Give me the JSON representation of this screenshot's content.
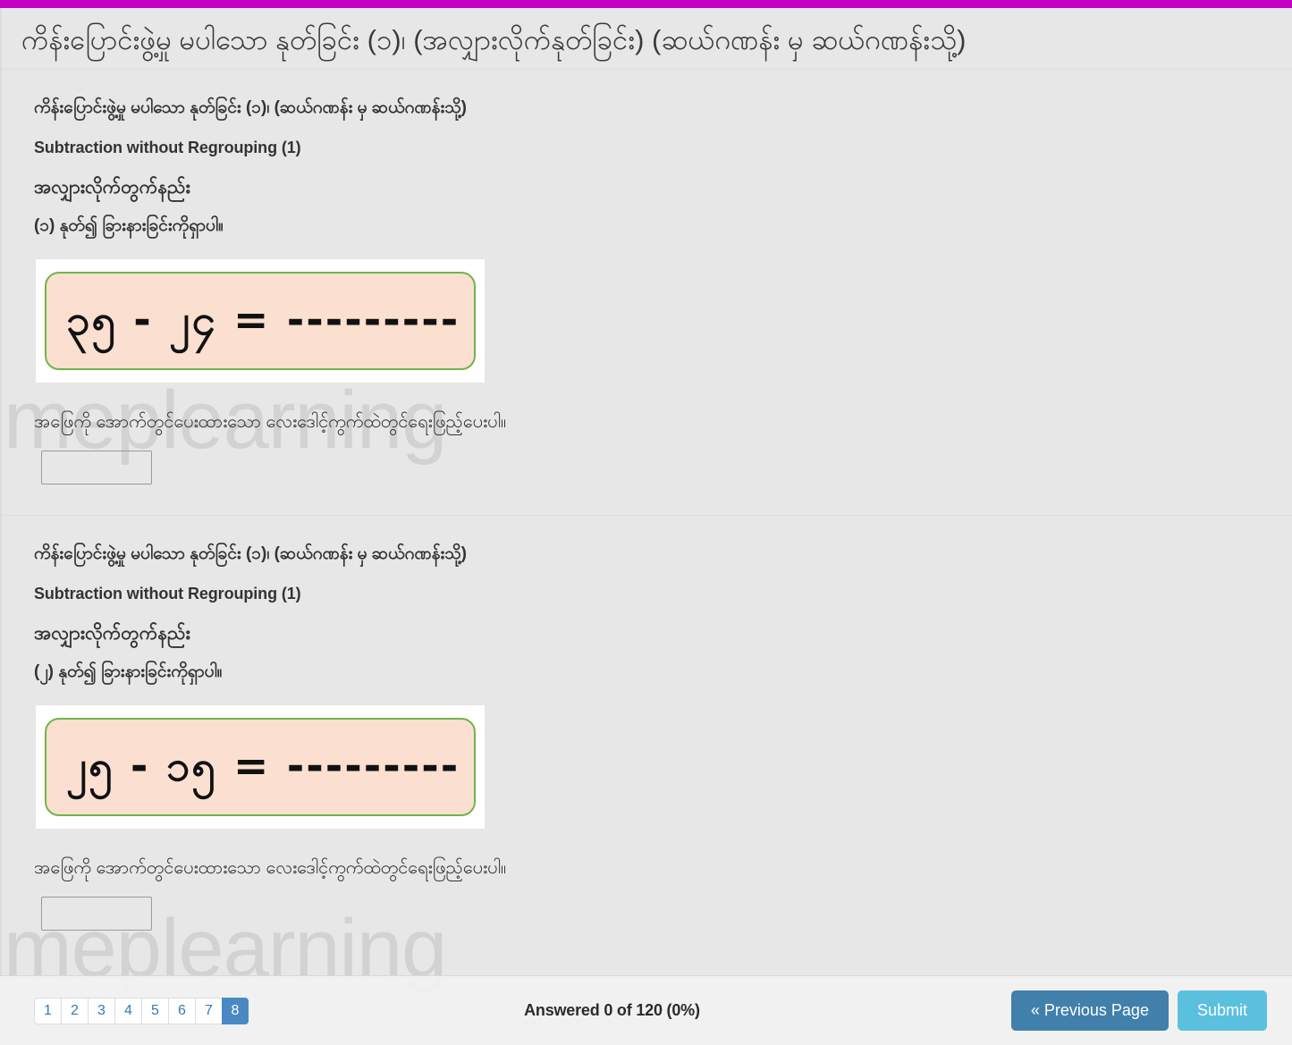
{
  "accent_color": "#c400c4",
  "watermark": {
    "text": "meplearning"
  },
  "header": {
    "title": "ကိန်းပြောင်းဖွဲ့မှု မပါသော နုတ်ခြင်း (၁)၊ (အလျှားလိုက်နုတ်ခြင်း) (ဆယ်ဂဏန်း မှ ဆယ်ဂဏန်းသို့)"
  },
  "questions": [
    {
      "my_title": "ကိန်းပြောင်းဖွဲ့မှု မပါသော နုတ်ခြင်း (၁)၊ (ဆယ်ဂဏန်း မှ ဆယ်ဂဏန်းသို့)",
      "en_title": "Subtraction without Regrouping (1)",
      "method": "အလျှားလိုက်တွက်နည်း",
      "instruction": "(၁) နုတ်၍ ခြားနားခြင်းကိုရှာပါ။",
      "expression": "၃၅ - ၂၄ = ---------",
      "answer_prompt": "အဖြေကို အောက်တွင်ပေးထားသော လေးဒေါင့်ကွက်ထဲတွင်ရေးဖြည့်ပေးပါ။",
      "answer_value": "",
      "answer_placeholder": ""
    },
    {
      "my_title": "ကိန်းပြောင်းဖွဲ့မှု မပါသော နုတ်ခြင်း (၁)၊ (ဆယ်ဂဏန်း မှ ဆယ်ဂဏန်းသို့)",
      "en_title": "Subtraction without Regrouping (1)",
      "method": "အလျှားလိုက်တွက်နည်း",
      "instruction": "(၂) နုတ်၍ ခြားနားခြင်းကိုရှာပါ။",
      "expression": "၂၅ - ၁၅ = ---------",
      "answer_prompt": "အဖြေကို အောက်တွင်ပေးထားသော လေးဒေါင့်ကွက်ထဲတွင်ရေးဖြည့်ပေးပါ။",
      "answer_value": "",
      "answer_placeholder": ""
    }
  ],
  "footer": {
    "pages": [
      {
        "label": "1",
        "active": false
      },
      {
        "label": "2",
        "active": false
      },
      {
        "label": "3",
        "active": false
      },
      {
        "label": "4",
        "active": false
      },
      {
        "label": "5",
        "active": false
      },
      {
        "label": "6",
        "active": false
      },
      {
        "label": "7",
        "active": false
      },
      {
        "label": "8",
        "active": true
      }
    ],
    "progress_status": "Answered 0 of 120 (0%)",
    "previous_label": "« Previous Page",
    "submit_label": "Submit",
    "previous_color": "#4180ab",
    "submit_color": "#5bc0de"
  }
}
